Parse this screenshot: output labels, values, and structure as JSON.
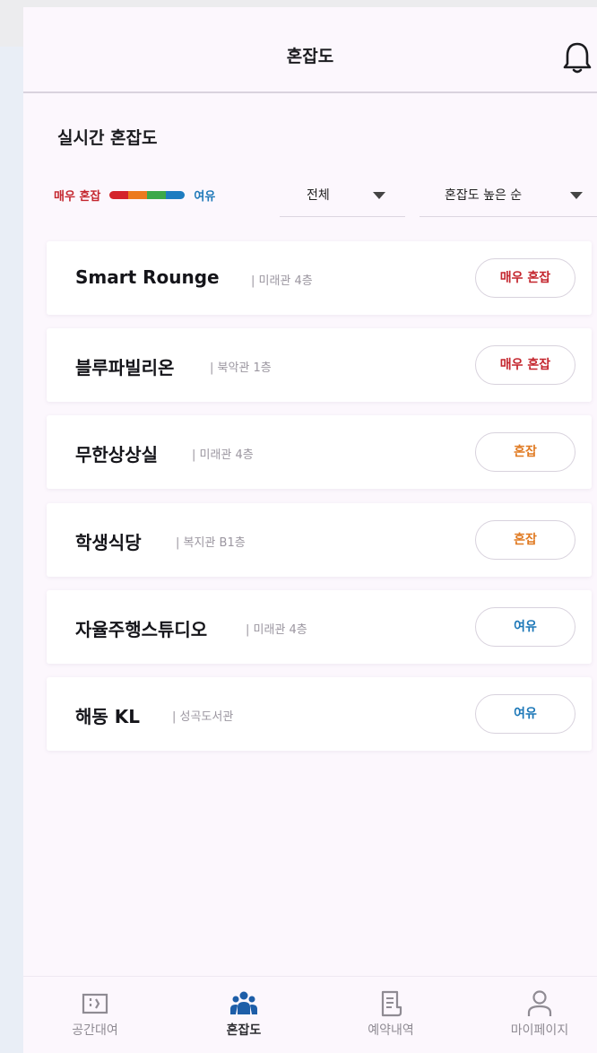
{
  "header": {
    "title": "혼잡도",
    "bell_icon": "bell-icon"
  },
  "section_title": "실시간 혼잡도",
  "legend": {
    "busy_label": "매우 혼잡",
    "free_label": "여유",
    "colors": [
      "#d4232b",
      "#ec7a1e",
      "#3ca84a",
      "#1e7cc0"
    ]
  },
  "filters": {
    "category": {
      "selected": "전체"
    },
    "sort": {
      "selected": "혼잡도 높은 순"
    }
  },
  "spaces": [
    {
      "name": "Smart Rounge",
      "location": "| 미래관 4층",
      "status": "매우 혼잡",
      "status_color": "#c4262e"
    },
    {
      "name": "블루파빌리온",
      "location": "| 북악관 1층",
      "status": "매우 혼잡",
      "status_color": "#c4262e"
    },
    {
      "name": "무한상상실",
      "location": "| 미래관 4층",
      "status": "혼잡",
      "status_color": "#e07a22"
    },
    {
      "name": "학생식당",
      "location": "| 복지관 B1층",
      "status": "혼잡",
      "status_color": "#e07a22"
    },
    {
      "name": "자율주행스튜디오",
      "location": "| 미래관 4층",
      "status": "여유",
      "status_color": "#1d78b8"
    },
    {
      "name": "해동 KL",
      "location": "| 성곡도서관",
      "status": "여유",
      "status_color": "#1d78b8"
    }
  ],
  "bottom_nav": {
    "items": [
      {
        "label": "공간대여",
        "icon": "ticket-icon",
        "active": false
      },
      {
        "label": "혼잡도",
        "icon": "people-icon",
        "active": true
      },
      {
        "label": "예약내역",
        "icon": "document-icon",
        "active": false
      },
      {
        "label": "마이페이지",
        "icon": "person-icon",
        "active": false
      }
    ]
  }
}
